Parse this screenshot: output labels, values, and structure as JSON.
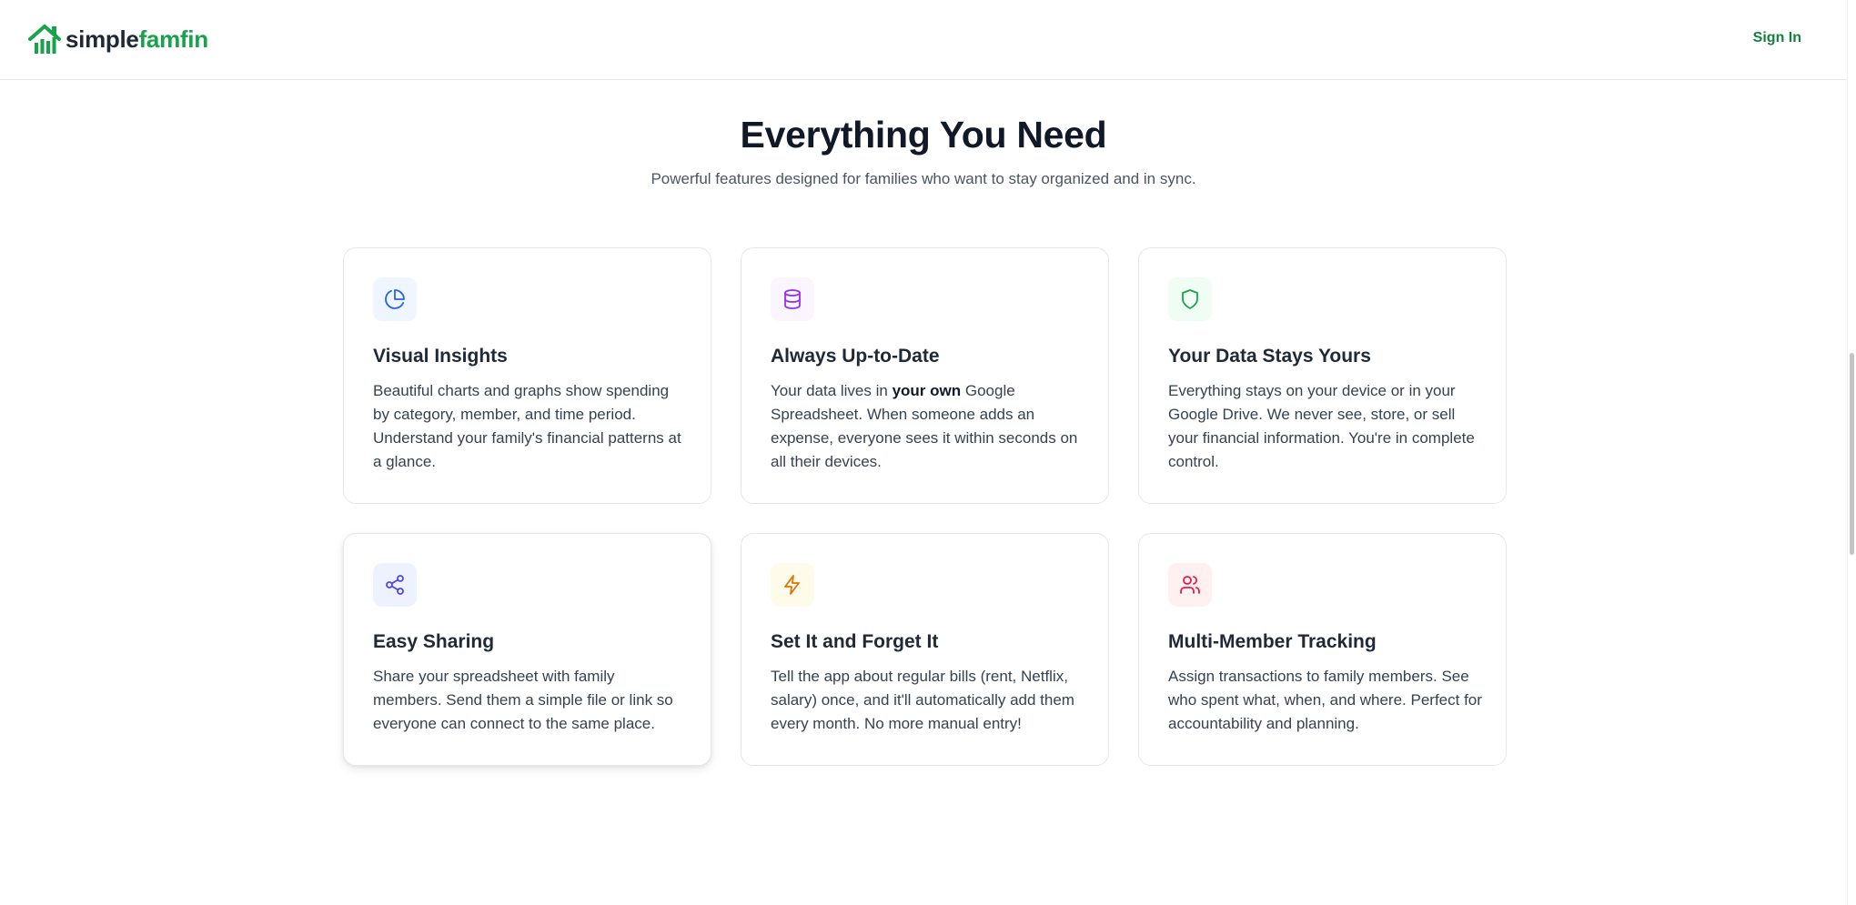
{
  "brand": {
    "name_part1": "simple",
    "name_part2": "famfin",
    "logo_icon": "house-chart-icon",
    "colors": {
      "primary": "#16a34a",
      "text": "#1f2937"
    }
  },
  "nav": {
    "sign_in_label": "Sign In"
  },
  "features": {
    "title": "Everything You Need",
    "subtitle": "Powerful features designed for families who want to stay organized and in sync.",
    "cards": [
      {
        "icon": "pie-chart-icon",
        "icon_color": "#2563eb",
        "icon_bg": "#eff6ff",
        "title": "Visual Insights",
        "description": "Beautiful charts and graphs show spending by category, member, and time period. Understand your family's financial patterns at a glance."
      },
      {
        "icon": "database-icon",
        "icon_color": "#9333ea",
        "icon_bg": "#faf5ff",
        "title": "Always Up-to-Date",
        "description_before": "Your data lives in ",
        "description_bold": "your own",
        "description_after": " Google Spreadsheet. When someone adds an expense, everyone sees it within seconds on all their devices."
      },
      {
        "icon": "shield-icon",
        "icon_color": "#16a34a",
        "icon_bg": "#f0fdf4",
        "title": "Your Data Stays Yours",
        "description": "Everything stays on your device or in your Google Drive. We never see, store, or sell your financial information. You're in complete control."
      },
      {
        "icon": "share-icon",
        "icon_color": "#4f46e5",
        "icon_bg": "#eef2ff",
        "title": "Easy Sharing",
        "description": "Share your spreadsheet with family members. Send them a simple file or link so everyone can connect to the same place."
      },
      {
        "icon": "lightning-icon",
        "icon_color": "#d97706",
        "icon_bg": "#fffbeb",
        "title": "Set It and Forget It",
        "description": "Tell the app about regular bills (rent, Netflix, salary) once, and it'll automatically add them every month. No more manual entry!"
      },
      {
        "icon": "users-icon",
        "icon_color": "#e11d48",
        "icon_bg": "#fff1f2",
        "title": "Multi-Member Tracking",
        "description": "Assign transactions to family members. See who spent what, when, and where. Perfect for accountability and planning."
      }
    ]
  }
}
